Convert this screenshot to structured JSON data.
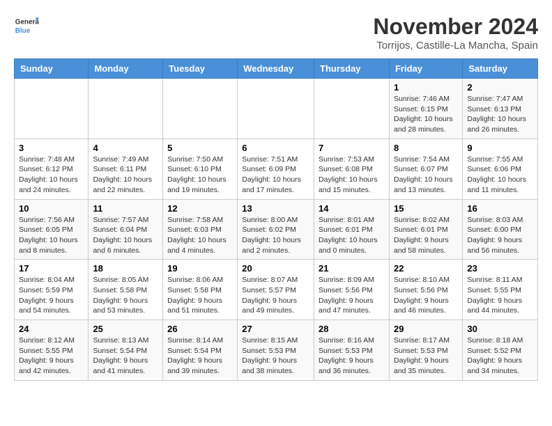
{
  "logo": {
    "text_general": "General",
    "text_blue": "Blue"
  },
  "header": {
    "month_title": "November 2024",
    "location": "Torrijos, Castille-La Mancha, Spain"
  },
  "days_of_week": [
    "Sunday",
    "Monday",
    "Tuesday",
    "Wednesday",
    "Thursday",
    "Friday",
    "Saturday"
  ],
  "weeks": [
    [
      {
        "day": "",
        "info": ""
      },
      {
        "day": "",
        "info": ""
      },
      {
        "day": "",
        "info": ""
      },
      {
        "day": "",
        "info": ""
      },
      {
        "day": "",
        "info": ""
      },
      {
        "day": "1",
        "info": "Sunrise: 7:46 AM\nSunset: 6:15 PM\nDaylight: 10 hours and 28 minutes."
      },
      {
        "day": "2",
        "info": "Sunrise: 7:47 AM\nSunset: 6:13 PM\nDaylight: 10 hours and 26 minutes."
      }
    ],
    [
      {
        "day": "3",
        "info": "Sunrise: 7:48 AM\nSunset: 6:12 PM\nDaylight: 10 hours and 24 minutes."
      },
      {
        "day": "4",
        "info": "Sunrise: 7:49 AM\nSunset: 6:11 PM\nDaylight: 10 hours and 22 minutes."
      },
      {
        "day": "5",
        "info": "Sunrise: 7:50 AM\nSunset: 6:10 PM\nDaylight: 10 hours and 19 minutes."
      },
      {
        "day": "6",
        "info": "Sunrise: 7:51 AM\nSunset: 6:09 PM\nDaylight: 10 hours and 17 minutes."
      },
      {
        "day": "7",
        "info": "Sunrise: 7:53 AM\nSunset: 6:08 PM\nDaylight: 10 hours and 15 minutes."
      },
      {
        "day": "8",
        "info": "Sunrise: 7:54 AM\nSunset: 6:07 PM\nDaylight: 10 hours and 13 minutes."
      },
      {
        "day": "9",
        "info": "Sunrise: 7:55 AM\nSunset: 6:06 PM\nDaylight: 10 hours and 11 minutes."
      }
    ],
    [
      {
        "day": "10",
        "info": "Sunrise: 7:56 AM\nSunset: 6:05 PM\nDaylight: 10 hours and 8 minutes."
      },
      {
        "day": "11",
        "info": "Sunrise: 7:57 AM\nSunset: 6:04 PM\nDaylight: 10 hours and 6 minutes."
      },
      {
        "day": "12",
        "info": "Sunrise: 7:58 AM\nSunset: 6:03 PM\nDaylight: 10 hours and 4 minutes."
      },
      {
        "day": "13",
        "info": "Sunrise: 8:00 AM\nSunset: 6:02 PM\nDaylight: 10 hours and 2 minutes."
      },
      {
        "day": "14",
        "info": "Sunrise: 8:01 AM\nSunset: 6:01 PM\nDaylight: 10 hours and 0 minutes."
      },
      {
        "day": "15",
        "info": "Sunrise: 8:02 AM\nSunset: 6:01 PM\nDaylight: 9 hours and 58 minutes."
      },
      {
        "day": "16",
        "info": "Sunrise: 8:03 AM\nSunset: 6:00 PM\nDaylight: 9 hours and 56 minutes."
      }
    ],
    [
      {
        "day": "17",
        "info": "Sunrise: 8:04 AM\nSunset: 5:59 PM\nDaylight: 9 hours and 54 minutes."
      },
      {
        "day": "18",
        "info": "Sunrise: 8:05 AM\nSunset: 5:58 PM\nDaylight: 9 hours and 53 minutes."
      },
      {
        "day": "19",
        "info": "Sunrise: 8:06 AM\nSunset: 5:58 PM\nDaylight: 9 hours and 51 minutes."
      },
      {
        "day": "20",
        "info": "Sunrise: 8:07 AM\nSunset: 5:57 PM\nDaylight: 9 hours and 49 minutes."
      },
      {
        "day": "21",
        "info": "Sunrise: 8:09 AM\nSunset: 5:56 PM\nDaylight: 9 hours and 47 minutes."
      },
      {
        "day": "22",
        "info": "Sunrise: 8:10 AM\nSunset: 5:56 PM\nDaylight: 9 hours and 46 minutes."
      },
      {
        "day": "23",
        "info": "Sunrise: 8:11 AM\nSunset: 5:55 PM\nDaylight: 9 hours and 44 minutes."
      }
    ],
    [
      {
        "day": "24",
        "info": "Sunrise: 8:12 AM\nSunset: 5:55 PM\nDaylight: 9 hours and 42 minutes."
      },
      {
        "day": "25",
        "info": "Sunrise: 8:13 AM\nSunset: 5:54 PM\nDaylight: 9 hours and 41 minutes."
      },
      {
        "day": "26",
        "info": "Sunrise: 8:14 AM\nSunset: 5:54 PM\nDaylight: 9 hours and 39 minutes."
      },
      {
        "day": "27",
        "info": "Sunrise: 8:15 AM\nSunset: 5:53 PM\nDaylight: 9 hours and 38 minutes."
      },
      {
        "day": "28",
        "info": "Sunrise: 8:16 AM\nSunset: 5:53 PM\nDaylight: 9 hours and 36 minutes."
      },
      {
        "day": "29",
        "info": "Sunrise: 8:17 AM\nSunset: 5:53 PM\nDaylight: 9 hours and 35 minutes."
      },
      {
        "day": "30",
        "info": "Sunrise: 8:18 AM\nSunset: 5:52 PM\nDaylight: 9 hours and 34 minutes."
      }
    ]
  ]
}
